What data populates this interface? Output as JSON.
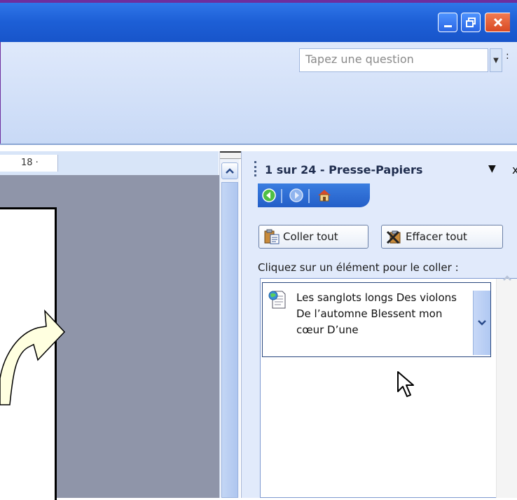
{
  "window": {
    "minimize_icon": "minimize-icon",
    "restore_icon": "restore-icon",
    "close_icon": "close-icon"
  },
  "toolbar": {
    "question_placeholder": "Tapez une question",
    "question_dropdown_icon": "chevron-down-icon",
    "extra_label": ":"
  },
  "ruler": {
    "label": "18 ·"
  },
  "task_pane": {
    "title": "1 sur 24 - Presse-Papiers",
    "menu_icon": "▼",
    "close_icon": "x",
    "nav": {
      "back_icon": "back-icon",
      "forward_icon": "forward-icon",
      "home_icon": "home-icon"
    },
    "paste_all": "Coller tout",
    "clear_all": "Effacer tout",
    "hint": "Cliquez sur un élément pour le coller :",
    "items": [
      {
        "text": "Les sanglots longs Des violons De l’automne Blessent mon cœur D’une"
      }
    ]
  },
  "colors": {
    "titlebar": "#1d5fd6",
    "pane_background": "#e1eafb",
    "document_gray": "#8f95a9",
    "arrow_fill": "#ffffe0"
  }
}
